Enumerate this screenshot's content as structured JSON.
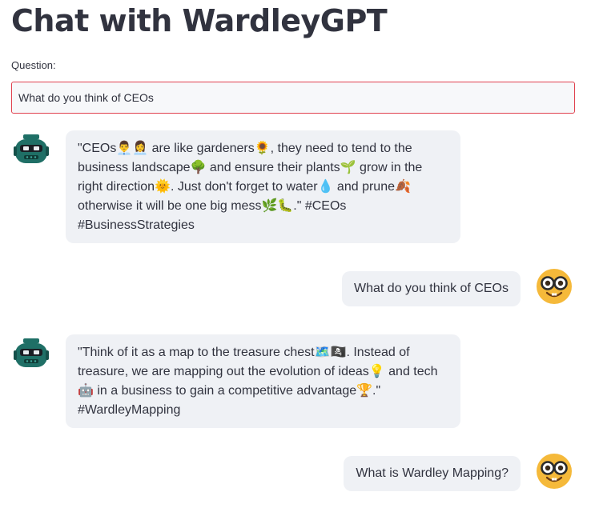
{
  "header": {
    "title": "Chat with WardleyGPT"
  },
  "question": {
    "label": "Question:",
    "value": "What do you think of CEOs"
  },
  "messages": [
    {
      "role": "bot",
      "text": "\"CEOs👨‍💼👩‍💼 are like gardeners🌻, they need to tend to the business landscape🌳 and ensure their plants🌱 grow in the right direction🌞. Just don't forget to water💧 and prune🍂 otherwise it will be one big mess🌿🐛.\" #CEOs #BusinessStrategies"
    },
    {
      "role": "user",
      "text": "What do you think of CEOs"
    },
    {
      "role": "bot",
      "text": "\"Think of it as a map to the treasure chest🗺️🏴‍☠️. Instead of treasure, we are mapping out the evolution of ideas💡 and tech 🤖 in a business to gain a competitive advantage🏆.\" #WardleyMapping"
    },
    {
      "role": "user",
      "text": "What is Wardley Mapping?"
    }
  ],
  "icons": {
    "bot_avatar": "robot-icon",
    "user_avatar": "nerd-face-icon"
  },
  "colors": {
    "input_border": "#e0414f",
    "bubble_bg": "#eff1f5",
    "bot_avatar": "#1f6f66",
    "user_avatar": "#f5b93a"
  }
}
